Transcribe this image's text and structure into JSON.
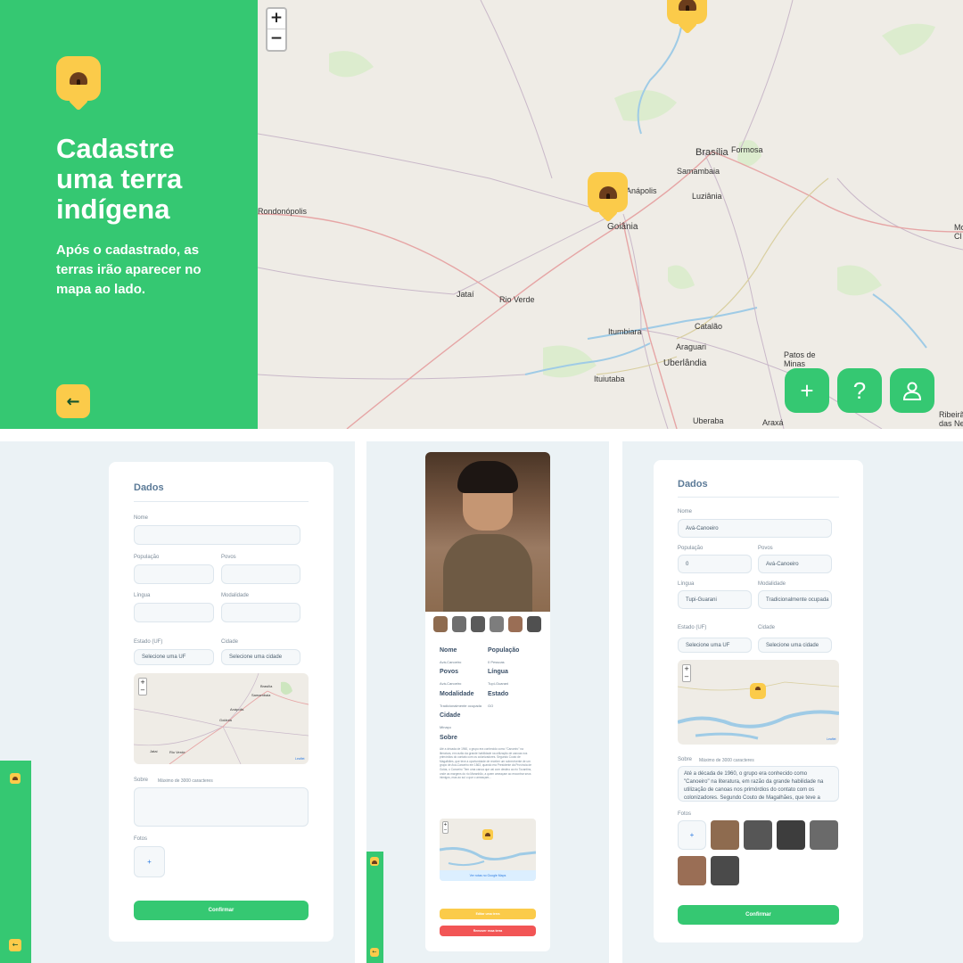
{
  "hero": {
    "title": "Cadastre uma terra indígena",
    "subtitle": "Após o cadastrado, as terras irão aparecer no mapa ao lado.",
    "back_icon": "arrow-left-icon"
  },
  "map": {
    "zoom_in": "+",
    "zoom_out": "−",
    "cities": [
      "Brasília",
      "Formosa",
      "Samambaia",
      "Anápolis",
      "Luziânia",
      "Goiânia",
      "Rondonópolis",
      "Jataí",
      "Rio Verde",
      "Itumbiara",
      "Catalão",
      "Araguari",
      "Uberlândia",
      "Patos de Minas",
      "Ituiutaba",
      "Uberaba",
      "Araxá",
      "Ribeirã das Ne",
      "Mo Cl"
    ],
    "fab": {
      "add_icon": "plus-icon",
      "add_label": "+",
      "help_label": "?",
      "profile_icon": "user-icon"
    }
  },
  "form_empty": {
    "title": "Dados",
    "name_label": "Nome",
    "population_label": "População",
    "peoples_label": "Povos",
    "language_label": "Língua",
    "modality_label": "Modalidade",
    "state_label": "Estado (UF)",
    "state_placeholder": "Selecione uma UF",
    "city_label": "Cidade",
    "city_placeholder": "Selecione uma cidade",
    "map_cities": [
      "Brasília",
      "Samambaia",
      "Anápolis",
      "Goiânia",
      "Jataí",
      "Rio Verde"
    ],
    "map_attribution": "Leaflet",
    "about_label": "Sobre",
    "about_hint": "Máximo de 3000 caracteres",
    "photos_label": "Fotos",
    "add_photo": "+",
    "confirm": "Confirmar"
  },
  "detail": {
    "fields": [
      {
        "h": "Nome",
        "v": "Avá-Canoeiro"
      },
      {
        "h": "População",
        "v": "0 Pessoas"
      },
      {
        "h": "Povos",
        "v": "Avá-Canoeiro"
      },
      {
        "h": "Língua",
        "v": "Tupi-Guarani"
      },
      {
        "h": "Modalidade",
        "v": "Tradicionalmente ocupada"
      },
      {
        "h": "Estado",
        "v": "GO"
      },
      {
        "h": "Cidade",
        "v": "Minaçu"
      }
    ],
    "about_heading": "Sobre",
    "about_text": "Até a década de 1960, o grupo era conhecido como \"Canoeiro\" na literatura, em razão da grande habilidade na utilização de canoas nos primórdios do contato com os colonizadores. Segundo Couto de Magalhães, que teve a oportunidade de receber um sobrevivente de um grupo de Avá-Canoeiro em 1863, quando era Presidente da Província de Goiás, o Canoeiro 'Tem uma canoa que vai com destino ao rio Tocantins, onde as margens do rio Maranhão, a quem ameaçam ao encontrar seus inimigos, mas ao sul o que o ameaçam...",
    "map_link": "Ver rotas no Google Maps",
    "edit": "Editar uma terra",
    "remove": "Remover essa terra"
  },
  "form_filled": {
    "title": "Dados",
    "name_label": "Nome",
    "name_value": "Avá-Canoeiro",
    "population_label": "População",
    "population_value": "0",
    "peoples_label": "Povos",
    "peoples_value": "Avá-Canoeiro",
    "language_label": "Língua",
    "language_value": "Tupi-Guarani",
    "modality_label": "Modalidade",
    "modality_value": "Tradicionalmente ocupada",
    "state_label": "Estado (UF)",
    "state_placeholder": "Selecione uma UF",
    "city_label": "Cidade",
    "city_placeholder": "Selecione uma cidade",
    "map_attribution": "Leaflet",
    "about_label": "Sobre",
    "about_hint": "Máximo de 3000 caracteres",
    "about_value": "Até a década de 1960, o grupo era conhecido como \"Canoeiro\" na literatura, em razão da grande habilidade na utilização de canoas nos primórdios do contato com os colonizadores. Segundo Couto de Magalhães, que teve a",
    "photos_label": "Fotos",
    "add_photo": "+",
    "confirm": "Confirmar"
  },
  "colors": {
    "green": "#35c872",
    "yellow": "#fbcb4a",
    "red": "#f25555",
    "bg": "#ebf2f5"
  }
}
